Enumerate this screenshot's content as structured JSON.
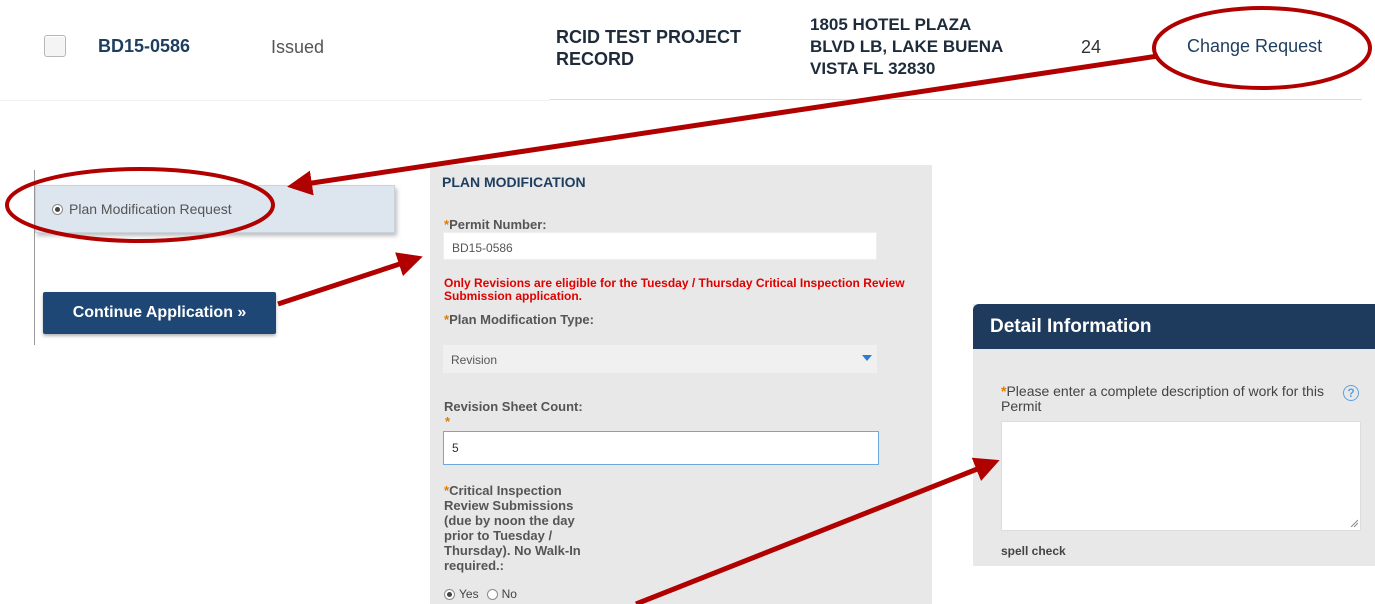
{
  "record": {
    "number": "BD15-0586",
    "status": "Issued",
    "project": "RCID TEST PROJECT RECORD",
    "address": "1805 HOTEL PLAZA BLVD LB, LAKE BUENA VISTA FL 32830",
    "count": "24",
    "action_link": "Change Request"
  },
  "left_panel": {
    "option_label": "Plan Modification Request",
    "continue_label": "Continue Application »"
  },
  "plan_form": {
    "title": "PLAN MODIFICATION",
    "required_mark": "*",
    "permit_label": "Permit Number:",
    "permit_value": "BD15-0586",
    "warning": "Only Revisions are eligible for the Tuesday / Thursday Critical Inspection Review Submission application.",
    "type_label": "Plan Modification Type:",
    "type_value": "Revision",
    "sheet_label": "Revision Sheet Count:",
    "sheet_value": "5",
    "critical_label": "Critical Inspection Review Submissions (due by noon the day prior to Tuesday / Thursday). No Walk-In required.:",
    "yes_label": "Yes",
    "no_label": "No"
  },
  "detail_panel": {
    "header": "Detail Information",
    "desc_label": "Please enter a complete description of work for this Permit",
    "help_glyph": "?",
    "spell_check": "spell check"
  },
  "colors": {
    "annotation": "#b00000",
    "header_navy": "#1e3a5c",
    "button_navy": "#1e4775",
    "required": "#e07b00",
    "warning": "#e00000"
  }
}
